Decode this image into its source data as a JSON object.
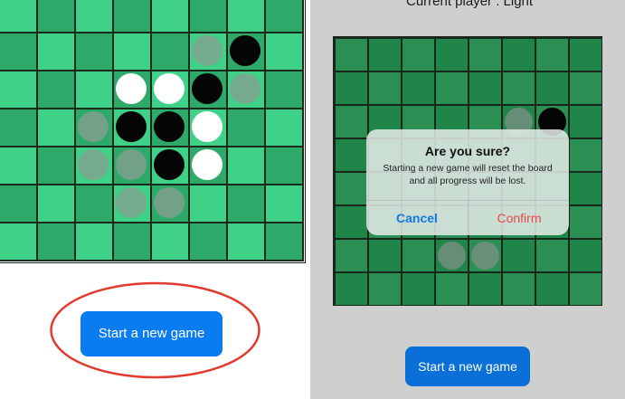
{
  "colors": {
    "cell_dark": "#2daa6a",
    "cell_light": "#3fd187",
    "cell_dark_right": "#23914f",
    "cell_light_right": "#2f9c5c",
    "piece_black": "#050505",
    "piece_white": "#ffffff",
    "piece_hint": "#8a9e92",
    "button_blue": "#0a7cf2",
    "cancel_blue": "#1377e5",
    "confirm_red": "#e8484b",
    "annotation_red": "#e23a2e"
  },
  "left_screen": {
    "new_game_label": "Start a new game",
    "board": [
      [
        "",
        "",
        "",
        "",
        "",
        "",
        "",
        ""
      ],
      [
        "",
        "",
        "",
        "",
        "",
        "H",
        "B",
        ""
      ],
      [
        "",
        "",
        "",
        "W",
        "W",
        "B",
        "H",
        ""
      ],
      [
        "",
        "",
        "H",
        "B",
        "B",
        "W",
        "",
        ""
      ],
      [
        "",
        "",
        "H",
        "H",
        "B",
        "W",
        "",
        ""
      ],
      [
        "",
        "",
        "",
        "H",
        "H",
        "",
        "",
        ""
      ],
      [
        "",
        "",
        "",
        "",
        "",
        "",
        "",
        ""
      ]
    ]
  },
  "right_screen": {
    "current_player_label": "Current player : Light",
    "new_game_label": "Start a new game",
    "board": [
      [
        "",
        "",
        "",
        "",
        "",
        "",
        "",
        ""
      ],
      [
        "",
        "",
        "",
        "",
        "",
        "",
        "",
        ""
      ],
      [
        "",
        "",
        "",
        "",
        "",
        "H",
        "B",
        ""
      ],
      [
        "",
        "",
        "",
        "",
        "",
        "",
        "",
        ""
      ],
      [
        "",
        "",
        "",
        "",
        "",
        "",
        "",
        ""
      ],
      [
        "",
        "",
        "",
        "",
        "",
        "",
        "",
        ""
      ],
      [
        "",
        "",
        "",
        "H",
        "H",
        "",
        "",
        ""
      ],
      [
        "",
        "",
        "",
        "",
        "",
        "",
        "",
        ""
      ]
    ],
    "dialog": {
      "title": "Are you sure?",
      "message": "Starting a new game will reset the board and all progress will be lost.",
      "cancel_label": "Cancel",
      "confirm_label": "Confirm"
    }
  }
}
